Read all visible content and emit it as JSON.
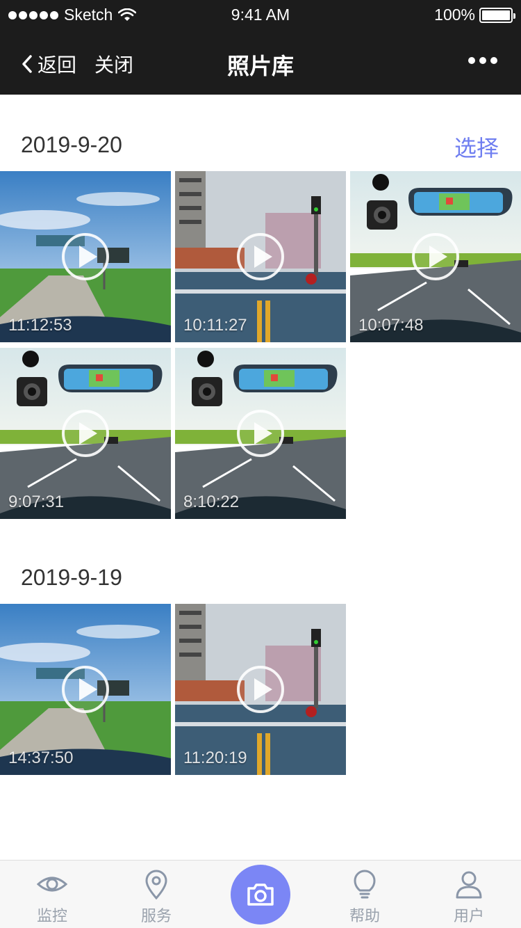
{
  "status_bar": {
    "carrier": "Sketch",
    "time": "9:41 AM",
    "battery": "100%"
  },
  "nav": {
    "back_label": "返回",
    "close_label": "关闭",
    "title": "照片库"
  },
  "sections": [
    {
      "date": "2019-9-20",
      "select_label": "选择",
      "items": [
        {
          "time": "11:12:53",
          "scene": "highway-sky"
        },
        {
          "time": "10:11:27",
          "scene": "city-road"
        },
        {
          "time": "10:07:48",
          "scene": "dashcam-promo"
        },
        {
          "time": "9:07:31",
          "scene": "dashcam-promo"
        },
        {
          "time": "8:10:22",
          "scene": "dashcam-promo"
        }
      ]
    },
    {
      "date": "2019-9-19",
      "items": [
        {
          "time": "14:37:50",
          "scene": "highway-sky"
        },
        {
          "time": "11:20:19",
          "scene": "city-road"
        }
      ]
    }
  ],
  "tabbar": {
    "tabs": [
      {
        "label": "监控",
        "icon": "eye-icon"
      },
      {
        "label": "服务",
        "icon": "location-pin-icon"
      },
      {
        "label": "帮助",
        "icon": "lightbulb-icon"
      },
      {
        "label": "用户",
        "icon": "user-icon"
      }
    ],
    "center_icon": "camera-icon",
    "accent_color": "#7b86f5"
  }
}
